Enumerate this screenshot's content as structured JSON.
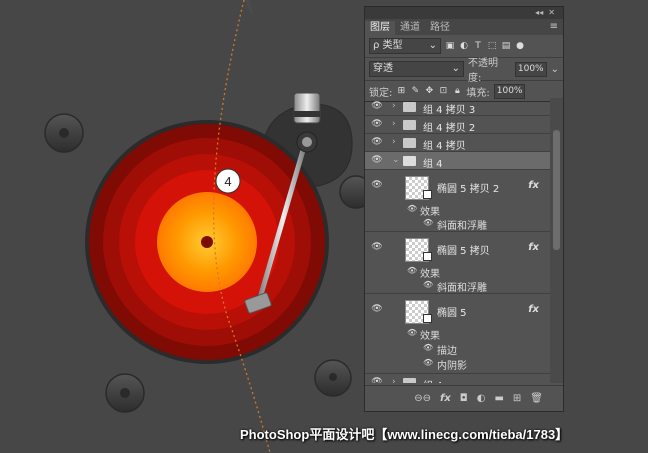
{
  "canvas": {
    "callout_number": "4",
    "watermark": "PhotoShop平面设计吧【www.linecg.com/tieba/1783】"
  },
  "panel": {
    "collapse_glyph": "◂◂",
    "close_glyph": "✕",
    "tabs": [
      {
        "label": "图层",
        "active": true
      },
      {
        "label": "通道",
        "active": false
      },
      {
        "label": "路径",
        "active": false
      }
    ],
    "filter_label": "ρ 类型",
    "blend_mode": "穿透",
    "opacity_label": "不透明度:",
    "opacity_value": "100%",
    "lock_label": "锁定:",
    "fill_label": "填充:",
    "fill_value": "100%",
    "layers": [
      {
        "name": "组 4 拷贝 3",
        "type": "group",
        "selected": false
      },
      {
        "name": "组 4 拷贝 2",
        "type": "group",
        "selected": false
      },
      {
        "name": "组 4 拷贝",
        "type": "group",
        "selected": false
      },
      {
        "name": "组 4",
        "type": "group",
        "selected": true,
        "expanded": true
      }
    ],
    "shape_layers": [
      {
        "name": "椭圆 5 拷贝 2",
        "effects_label": "效果",
        "effects": [
          "斜面和浮雕"
        ]
      },
      {
        "name": "椭圆 5 拷贝",
        "effects_label": "效果",
        "effects": [
          "斜面和浮雕"
        ]
      },
      {
        "name": "椭圆 5",
        "effects_label": "效果",
        "effects": [
          "描边",
          "内阴影"
        ]
      }
    ],
    "partial_layer": "组 4",
    "fx_label": "fx",
    "bottom_icons": [
      "link-icon",
      "fx-icon",
      "mask-icon",
      "adjustment-icon",
      "folder-icon",
      "new-layer-icon",
      "trash-icon"
    ],
    "bottom_glyphs": [
      "⊖⊖",
      "fx",
      "◘",
      "◐",
      "▬",
      "⊞",
      "🗑"
    ]
  },
  "colors": {
    "background": "#444444",
    "record_outer": "#8c0a05",
    "record_center": "#ff9a00",
    "panel_bg": "#535353"
  }
}
